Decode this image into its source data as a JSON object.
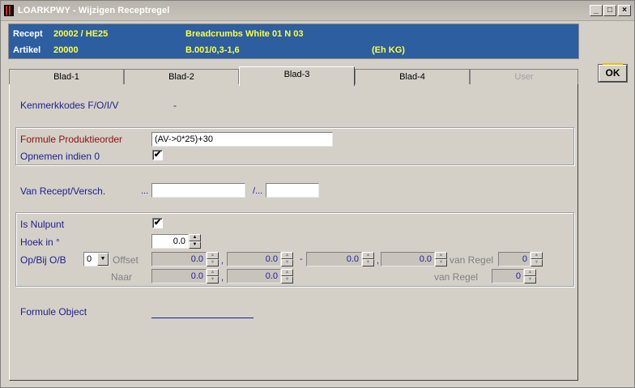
{
  "window": {
    "title": "LOARKPWY - Wijzigen Receptregel",
    "minimize_label": "_",
    "maximize_label": "□",
    "close_label": "×"
  },
  "header": {
    "recept_label": "Recept",
    "recept_value": "20002 / HE25",
    "recept_desc": "Breadcrumbs White 01 N 03",
    "artikel_label": "Artikel",
    "artikel_value": "20000",
    "artikel_desc": "B.001/0,3-1,6",
    "artikel_unit": "(Eh KG)"
  },
  "tabs": [
    {
      "label": "Blad-1",
      "state": "normal"
    },
    {
      "label": "Blad-2",
      "state": "normal"
    },
    {
      "label": "Blad-3",
      "state": "active"
    },
    {
      "label": "Blad-4",
      "state": "normal"
    },
    {
      "label": "User",
      "state": "disabled"
    }
  ],
  "ok_button": "OK",
  "form": {
    "kenmerk_label": "Kenmerkkodes F/O/I/V",
    "kenmerk_value": "-",
    "formule_prod_label": "Formule Produktieorder",
    "formule_prod_value": "(AV->0*25)+30",
    "opnemen_label": "Opnemen indien 0",
    "opnemen_checked": "✔",
    "van_recept_label": "Van Recept/Versch.",
    "van_recept_dots": "...",
    "van_recept_value": "",
    "versch_sep": "/...",
    "versch_value": "",
    "is_nulpunt_label": "Is Nulpunt",
    "is_nulpunt_checked": "✔",
    "hoek_label": "Hoek in °",
    "hoek_value": "0.0",
    "opbij_label": "Op/Bij O/B",
    "opbij_value": "0",
    "offset_label": "Offset",
    "offset_x": "0.0",
    "offset_y": "0.0",
    "offset_sep": "-",
    "offset_x2": "0.0",
    "offset_y2": "0.0",
    "comma1": ",",
    "comma2": ",",
    "comma3": ",",
    "van_regel_label": "van Regel",
    "van_regel_value": "0",
    "naar_label": "Naar",
    "naar_x": "0.0",
    "naar_y": "0.0",
    "van_regel2_label": "van Regel",
    "van_regel2_value": "0",
    "formule_object_label": "Formule Object"
  },
  "colors": {
    "header_bg": "#2c5ea0",
    "header_value": "#ffff40",
    "label_blue": "#202090",
    "label_red": "#8a1010"
  }
}
